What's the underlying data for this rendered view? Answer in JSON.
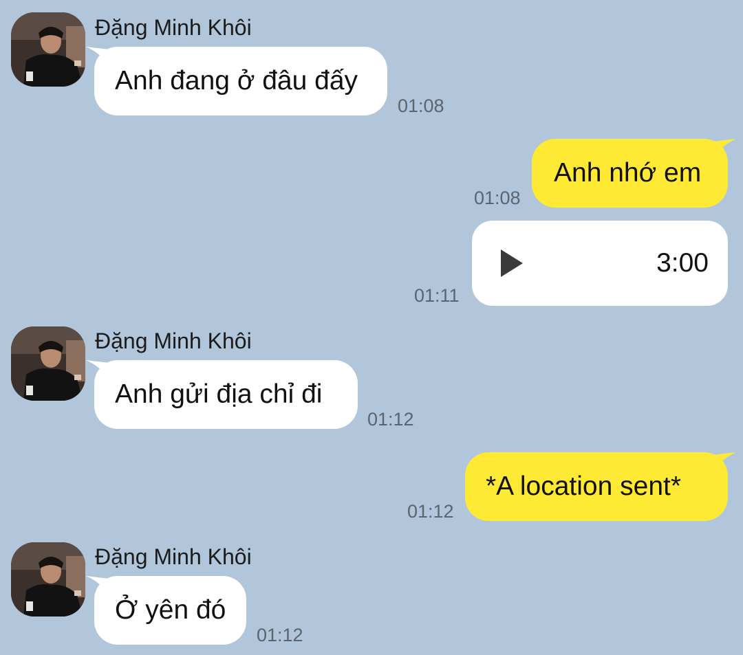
{
  "messages": [
    {
      "sender": "Đặng Minh Khôi",
      "text": "Anh đang ở đâu đấy",
      "time": "01:08"
    },
    {
      "text": "Anh nhớ em",
      "time": "01:08"
    },
    {
      "voice_duration": "3:00",
      "time": "01:11"
    },
    {
      "sender": "Đặng Minh Khôi",
      "text": "Anh gửi địa chỉ đi",
      "time": "01:12"
    },
    {
      "text": "*A location sent*",
      "time": "01:12"
    },
    {
      "sender": "Đặng Minh Khôi",
      "text": "Ở yên đó",
      "time": "01:12"
    }
  ],
  "colors": {
    "background": "#b1c6da",
    "incoming_bubble": "#ffffff",
    "outgoing_bubble": "#fee934",
    "timestamp": "#5b6570"
  },
  "icons": {
    "play": "play-icon",
    "avatar": "avatar"
  }
}
